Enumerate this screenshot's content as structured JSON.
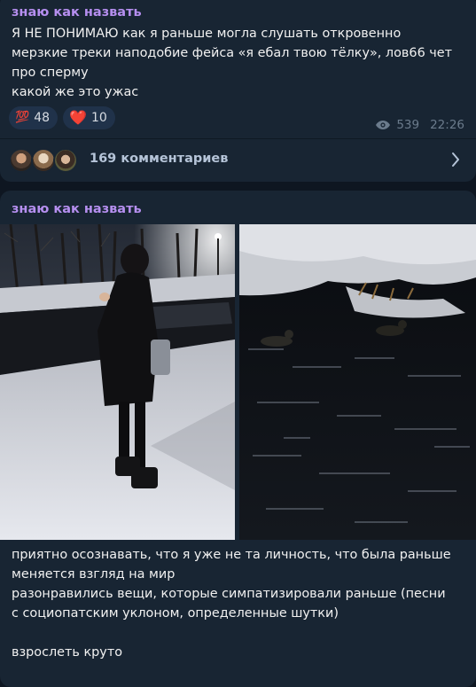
{
  "post1": {
    "author": "знаю как назвать",
    "lines": [
      "Я НЕ ПОНИМАЮ как я раньше могла слушать откровенно",
      "мерзкие треки наподобие фейса «я ебал твою тёлку», лов66 чет",
      "про сперму",
      "какой же это ужас"
    ],
    "reactions": [
      {
        "emoji": "💯",
        "count": "48"
      },
      {
        "emoji": "❤️",
        "count": "10"
      }
    ],
    "views": "539",
    "time": "22:26",
    "comments_label": "169 комментариев"
  },
  "post2": {
    "author": "знаю как назвать",
    "lines": [
      "приятно осознавать, что я уже не та личность, что была раньше",
      "меняется взгляд на мир",
      "разонравились вещи, которые симпатизировали раньше (песни",
      "с социопатским уклоном, определенные шутки)",
      "",
      "взрослеть круто"
    ]
  },
  "icons": {
    "views": "eye-icon",
    "comments_arrow": "chevron-right-icon"
  },
  "colors": {
    "background": "#0e1621",
    "bubble": "#182533",
    "author": "#b68ff0",
    "reaction_bg": "#20324a",
    "meta": "#6b7b8c",
    "link": "#b5c4d8"
  }
}
